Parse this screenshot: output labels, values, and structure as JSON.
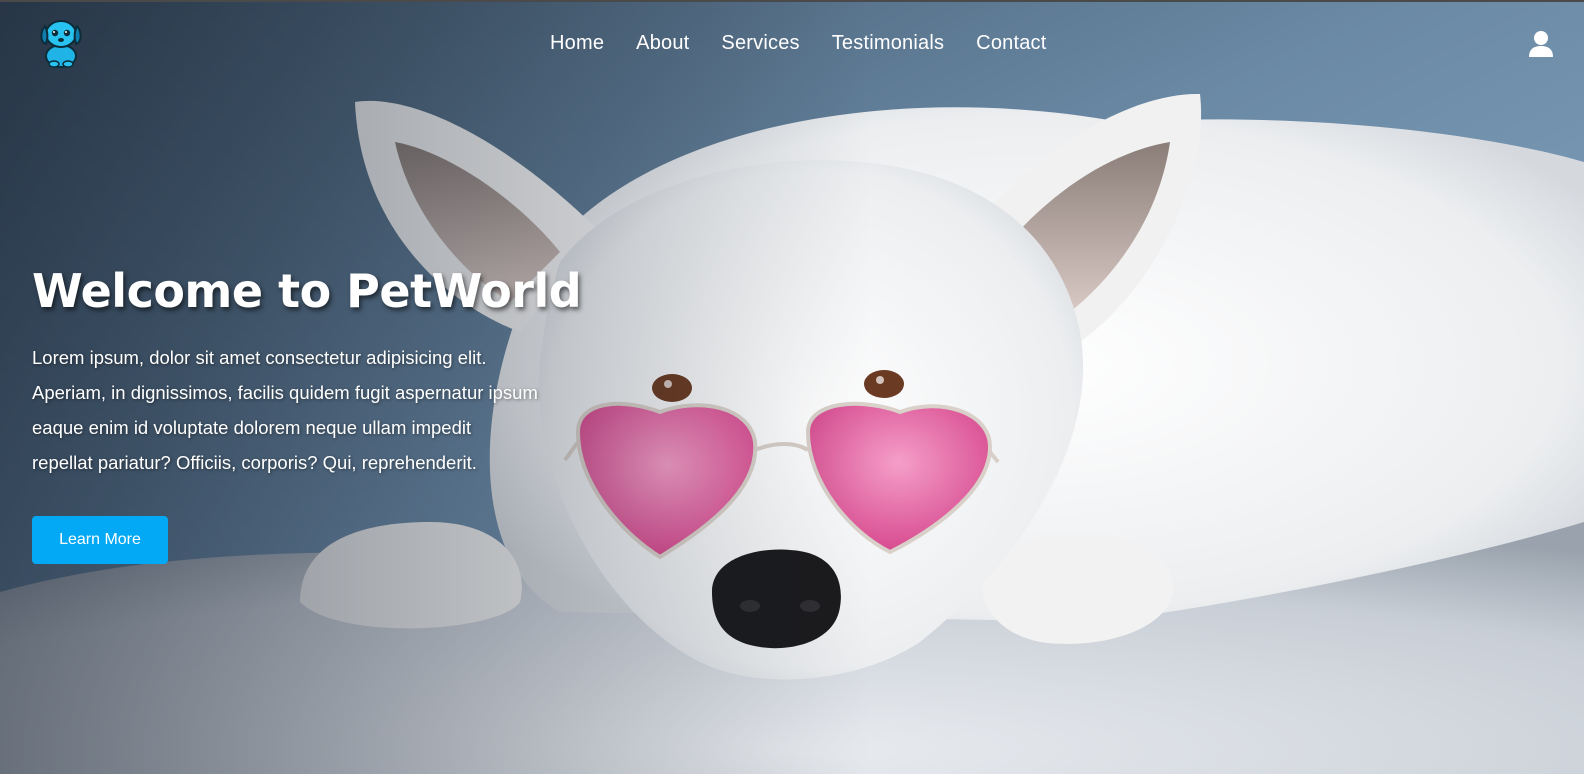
{
  "nav": {
    "items": [
      {
        "label": "Home"
      },
      {
        "label": "About"
      },
      {
        "label": "Services"
      },
      {
        "label": "Testimonials"
      },
      {
        "label": "Contact"
      }
    ]
  },
  "hero": {
    "title": "Welcome to PetWorld",
    "description_lines": [
      "Lorem ipsum, dolor sit amet consectetur adipisicing elit.",
      "Aperiam, in dignissimos, facilis quidem fugit aspernatur ipsum",
      "eaque enim id voluptate dolorem neque ullam impedit",
      "repellat pariatur? Officiis, corporis? Qui, reprehenderit."
    ],
    "cta_label": "Learn More"
  },
  "icons": {
    "logo": "puppy-logo-icon",
    "user": "user-icon"
  },
  "colors": {
    "accent": "#03a9f4",
    "text": "#ffffff",
    "sunglasses": "#e85aa0"
  }
}
